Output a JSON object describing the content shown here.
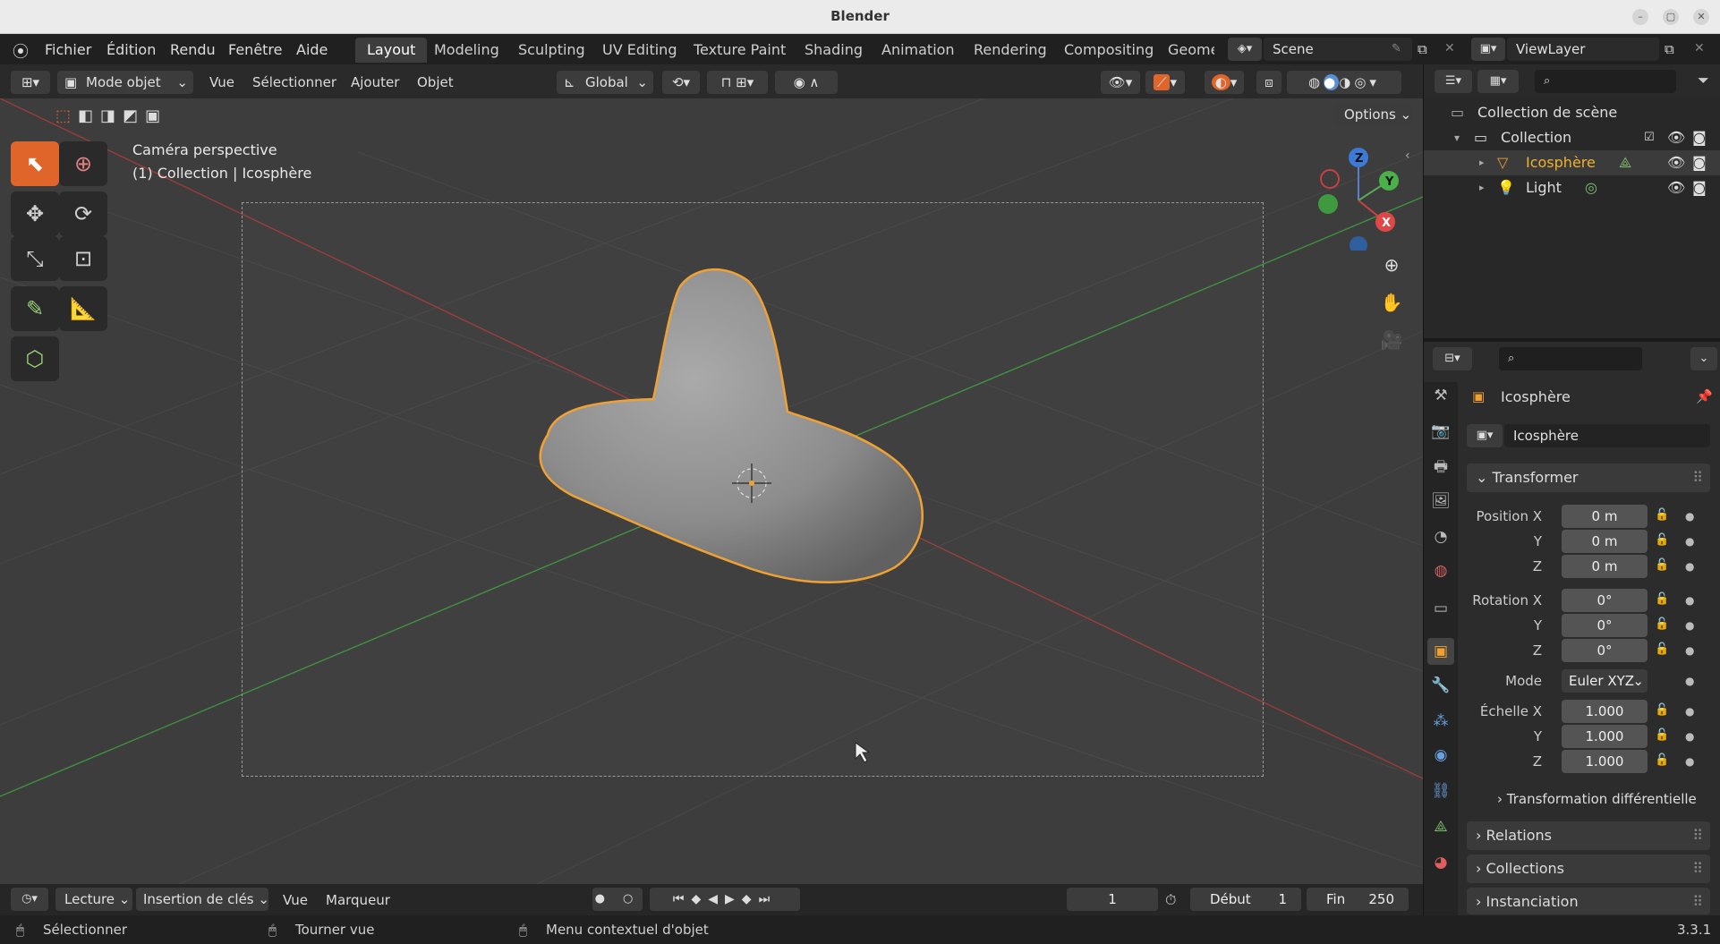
{
  "window": {
    "title": "Blender",
    "version": "3.3.1"
  },
  "menubar": {
    "menus": [
      "Fichier",
      "Édition",
      "Rendu",
      "Fenêtre",
      "Aide"
    ],
    "workspaces": [
      "Layout",
      "Modeling",
      "Sculpting",
      "UV Editing",
      "Texture Paint",
      "Shading",
      "Animation",
      "Rendering",
      "Compositing",
      "Geome"
    ],
    "active_workspace": "Layout",
    "scene": "Scene",
    "view_layer": "ViewLayer"
  },
  "viewport_header": {
    "mode": "Mode objet",
    "menus": [
      "Vue",
      "Sélectionner",
      "Ajouter",
      "Objet"
    ],
    "transform_orientation": "Global",
    "options_label": "Options"
  },
  "viewport": {
    "camera_label": "Caméra perspective",
    "collection_label": "(1) Collection | Icosphère",
    "gizmo": {
      "z": "Z",
      "y": "Y",
      "x": "X"
    }
  },
  "outliner": {
    "root": "Collection de scène",
    "collection": "Collection",
    "items": [
      "Icosphère",
      "Light"
    ]
  },
  "properties": {
    "object_name": "Icosphère",
    "datablock_name": "Icosphère",
    "transform_header": "Transformer",
    "position_label": "Position X",
    "rotation_label": "Rotation X",
    "scale_label": "Échelle X",
    "y_label": "Y",
    "z_label": "Z",
    "mode_label": "Mode",
    "mode_value": "Euler XYZ",
    "position": [
      "0 m",
      "0 m",
      "0 m"
    ],
    "rotation": [
      "0°",
      "0°",
      "0°"
    ],
    "scale": [
      "1.000",
      "1.000",
      "1.000"
    ],
    "delta_transform": "Transformation différentielle",
    "sections": [
      "Relations",
      "Collections",
      "Instanciation"
    ]
  },
  "timeline": {
    "menus": [
      "Lecture",
      "Insertion de clés",
      "Vue",
      "Marqueur"
    ],
    "current_frame": "1",
    "start_label": "Début",
    "start_value": "1",
    "end_label": "Fin",
    "end_value": "250"
  },
  "statusbar": {
    "left_click": "Sélectionner",
    "middle_click": "Tourner vue",
    "right_click": "Menu contextuel d'objet"
  },
  "colors": {
    "accent_orange": "#e0652a",
    "selection_outline": "#f0a030",
    "x_axis": "#c84040",
    "y_axis": "#4ab04a"
  }
}
